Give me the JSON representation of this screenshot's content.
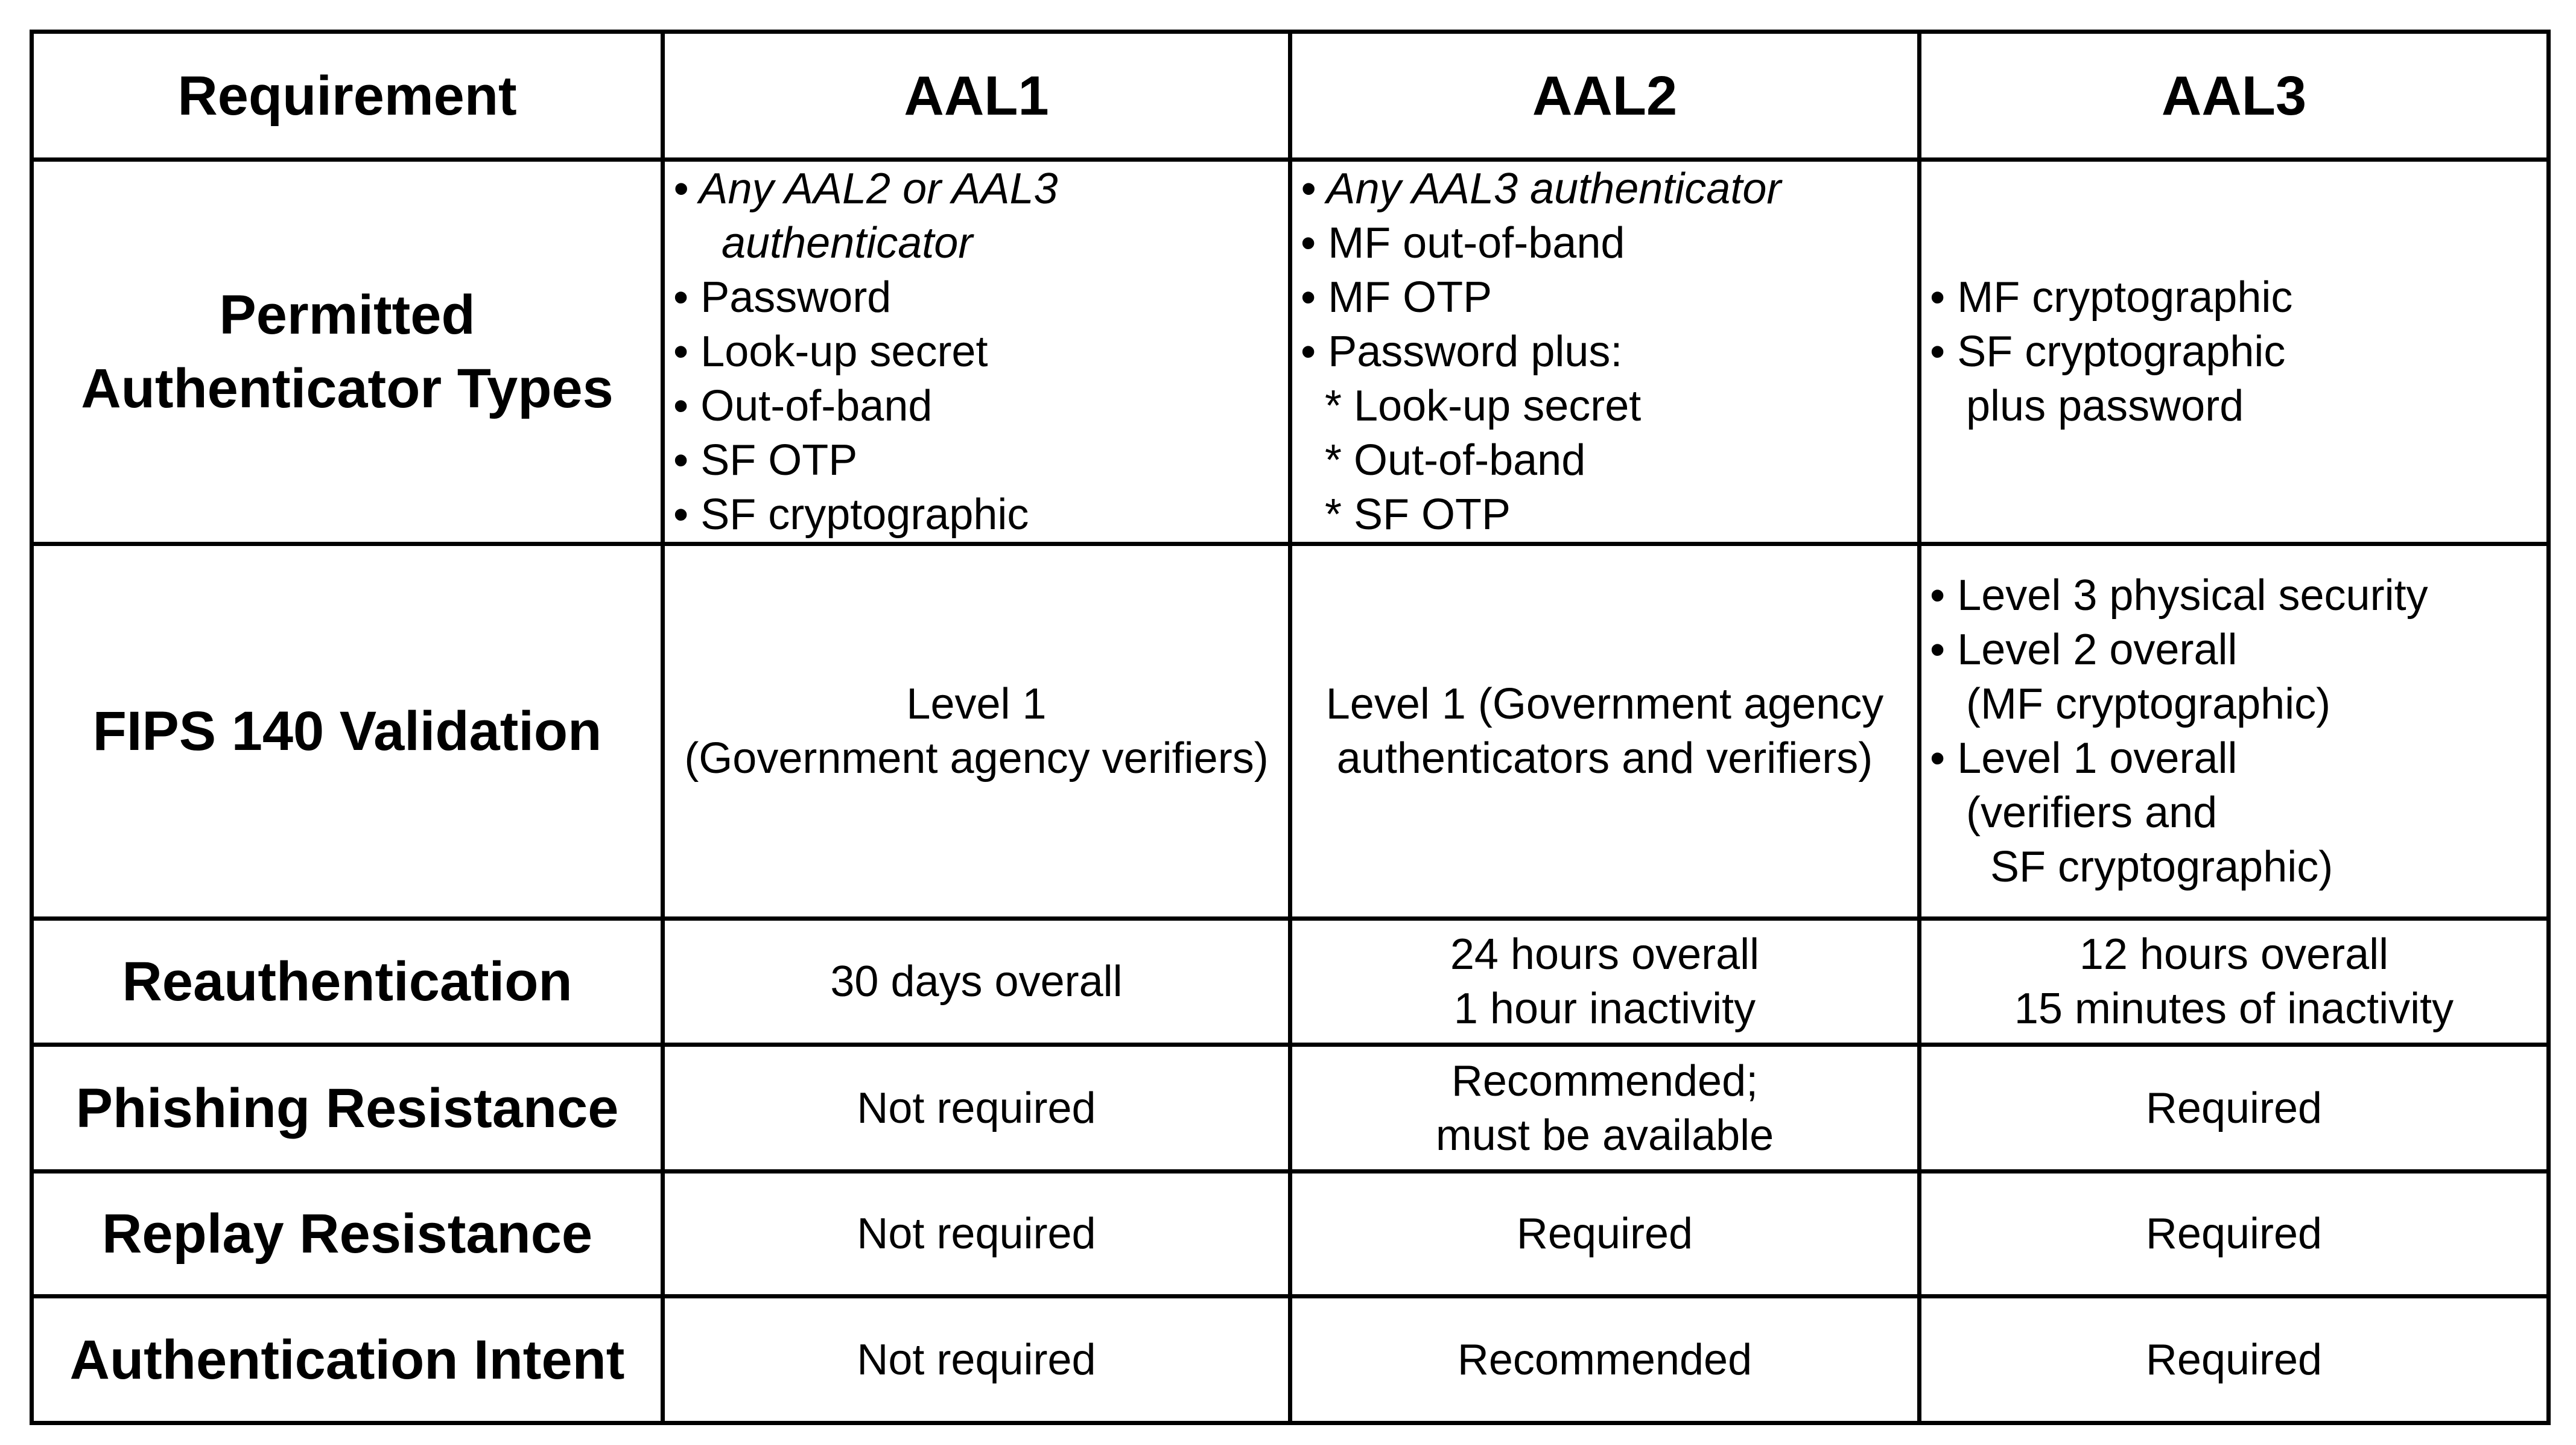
{
  "header": [
    "Requirement",
    "AAL1",
    "AAL2",
    "AAL3"
  ],
  "rows": [
    {
      "label": [
        "Permitted",
        "Authenticator Types"
      ],
      "cells": [
        {
          "align": "left",
          "lines": [
            {
              "text": "• Any AAL2 or AAL3",
              "italic": true
            },
            {
              "text": "    authenticator",
              "italic": true
            },
            {
              "text": "• Password"
            },
            {
              "text": "• Look-up secret"
            },
            {
              "text": "• Out-of-band"
            },
            {
              "text": "• SF OTP"
            },
            {
              "text": "• SF cryptographic"
            }
          ]
        },
        {
          "align": "left",
          "lines": [
            {
              "text": "• Any AAL3 authenticator",
              "italic": true
            },
            {
              "text": "• MF out-of-band"
            },
            {
              "text": "• MF OTP"
            },
            {
              "text": "• Password plus:"
            },
            {
              "text": "  * Look-up secret"
            },
            {
              "text": "  * Out-of-band"
            },
            {
              "text": "  * SF OTP"
            }
          ]
        },
        {
          "align": "left",
          "lines": [
            {
              "text": "• MF cryptographic"
            },
            {
              "text": "• SF cryptographic"
            },
            {
              "text": "   plus password"
            }
          ]
        }
      ]
    },
    {
      "label": [
        "FIPS 140 Validation"
      ],
      "cells": [
        {
          "align": "center",
          "lines": [
            {
              "text": "Level 1"
            },
            {
              "text": "(Government agency verifiers)"
            }
          ]
        },
        {
          "align": "center",
          "lines": [
            {
              "text": "Level 1 (Government agency"
            },
            {
              "text": "authenticators and verifiers)"
            }
          ]
        },
        {
          "align": "left",
          "lines": [
            {
              "text": "• Level 3 physical security"
            },
            {
              "text": "• Level 2 overall"
            },
            {
              "text": "   (MF cryptographic)"
            },
            {
              "text": "• Level 1 overall"
            },
            {
              "text": "   (verifiers and"
            },
            {
              "text": "     SF cryptographic)"
            }
          ]
        }
      ]
    },
    {
      "label": [
        "Reauthentication"
      ],
      "cells": [
        {
          "align": "center",
          "lines": [
            {
              "text": "30 days overall"
            }
          ]
        },
        {
          "align": "center",
          "lines": [
            {
              "text": "24 hours overall"
            },
            {
              "text": "1 hour inactivity"
            }
          ]
        },
        {
          "align": "center",
          "lines": [
            {
              "text": "12 hours overall"
            },
            {
              "text": "15 minutes of inactivity"
            }
          ]
        }
      ]
    },
    {
      "label": [
        "Phishing Resistance"
      ],
      "cells": [
        {
          "align": "center",
          "lines": [
            {
              "text": "Not required"
            }
          ]
        },
        {
          "align": "center",
          "lines": [
            {
              "text": "Recommended;"
            },
            {
              "text": "must be available"
            }
          ]
        },
        {
          "align": "center",
          "lines": [
            {
              "text": "Required"
            }
          ]
        }
      ]
    },
    {
      "label": [
        "Replay Resistance"
      ],
      "cells": [
        {
          "align": "center",
          "lines": [
            {
              "text": "Not required"
            }
          ]
        },
        {
          "align": "center",
          "lines": [
            {
              "text": "Required"
            }
          ]
        },
        {
          "align": "center",
          "lines": [
            {
              "text": "Required"
            }
          ]
        }
      ]
    },
    {
      "label": [
        "Authentication Intent"
      ],
      "cells": [
        {
          "align": "center",
          "lines": [
            {
              "text": "Not required"
            }
          ]
        },
        {
          "align": "center",
          "lines": [
            {
              "text": "Recommended"
            }
          ]
        },
        {
          "align": "center",
          "lines": [
            {
              "text": "Required"
            }
          ]
        }
      ]
    }
  ]
}
